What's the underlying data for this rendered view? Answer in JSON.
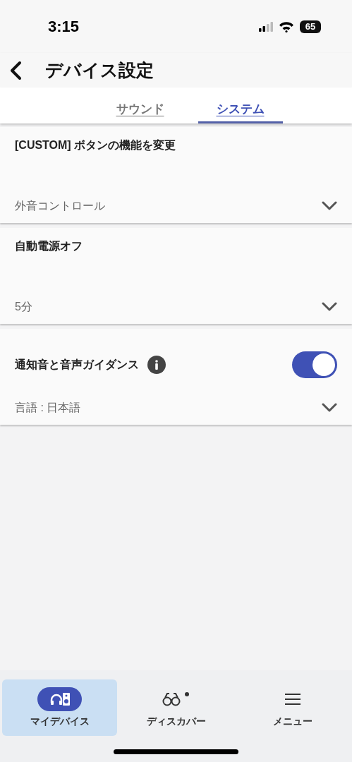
{
  "status_bar": {
    "time": "3:15",
    "battery": "65"
  },
  "header": {
    "title": "デバイス設定"
  },
  "tabs": [
    {
      "label": "サウンド",
      "selected": false
    },
    {
      "label": "システム",
      "selected": true
    }
  ],
  "settings": [
    {
      "kind": "select",
      "title": "[CUSTOM] ボタンの機能を変更",
      "value": "外音コントロール"
    },
    {
      "kind": "select",
      "title": "自動電源オフ",
      "value": "5分"
    },
    {
      "kind": "toggle",
      "title": "通知音と音声ガイダンス",
      "on": true,
      "value": "言語 : 日本語"
    }
  ],
  "bottom_nav": [
    {
      "kind": "devices",
      "label": "マイデバイス",
      "selected": true
    },
    {
      "kind": "discover",
      "label": "ディスカバー",
      "selected": false
    },
    {
      "kind": "menu",
      "label": "メニュー",
      "selected": false
    }
  ]
}
